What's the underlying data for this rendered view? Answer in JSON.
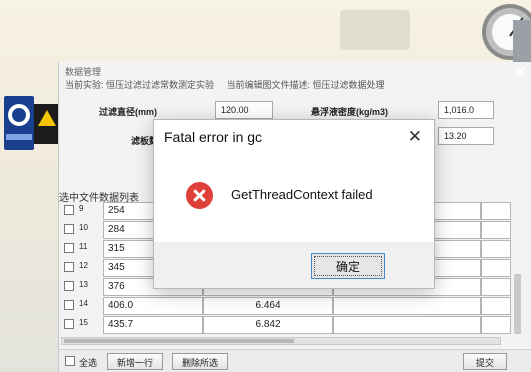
{
  "app": {
    "title": "数据管理",
    "subtitle_experiment": "当前实验: 恒压过滤过滤常数测定实验",
    "subtitle_file": "当前编辑图文件描述: 恒压过滤数据处理"
  },
  "fields": {
    "filter_diameter_label": "过滤直径(mm)",
    "filter_diameter_value": "120.00",
    "suspension_density_label": "悬浮液密度(kg/m3)",
    "suspension_density_value": "1,016.0",
    "filter_area_label": "滤板数",
    "filter_area_value": "13.20"
  },
  "list_title": "选中文件数据列表",
  "rows": [
    {
      "idx": "9",
      "c1": "254",
      "c2": ""
    },
    {
      "idx": "10",
      "c1": "284",
      "c2": ""
    },
    {
      "idx": "11",
      "c1": "315",
      "c2": ""
    },
    {
      "idx": "12",
      "c1": "345",
      "c2": ""
    },
    {
      "idx": "13",
      "c1": "376",
      "c2": ""
    },
    {
      "idx": "14",
      "c1": "406.0",
      "c2": "6.464"
    },
    {
      "idx": "15",
      "c1": "435.7",
      "c2": "6.842"
    }
  ],
  "bottom": {
    "select_all": "全选",
    "add_row": "新增一行",
    "delete_selected": "删除所选",
    "submit": "提交"
  },
  "dialog": {
    "title": "Fatal error in gc",
    "close": "✕",
    "message": "GetThreadContext failed",
    "ok": "确定"
  },
  "colors": {
    "error_red": "#e0403a",
    "ok_border": "#4a86c8"
  }
}
